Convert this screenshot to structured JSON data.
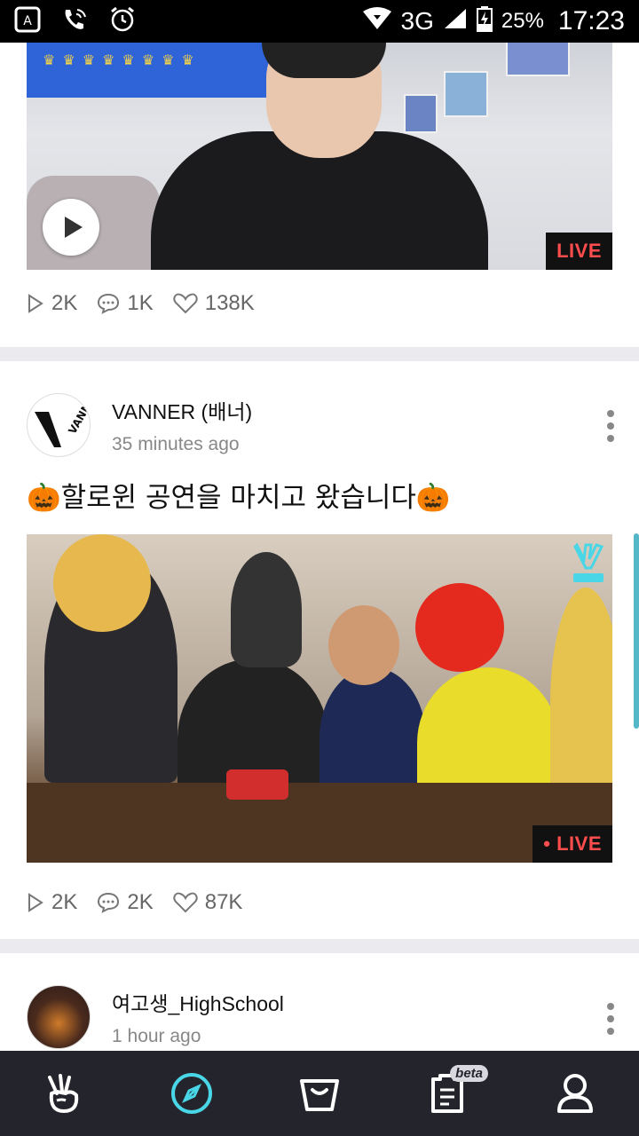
{
  "status_bar": {
    "network": "3G",
    "battery": "25%",
    "time": "17:23"
  },
  "posts": [
    {
      "live_label": "LIVE",
      "plays": "2K",
      "comments": "1K",
      "likes": "138K"
    },
    {
      "author": "VANNER (배너)",
      "time_ago": "35 minutes ago",
      "text": "🎃할로윈 공연을 마치고 왔습니다🎃",
      "live_label": "• LIVE",
      "plays": "2K",
      "comments": "2K",
      "likes": "87K"
    },
    {
      "author": "여고생_HighSchool",
      "time_ago": "1 hour ago"
    }
  ],
  "nav": {
    "items": [
      "home-icon",
      "discover-icon",
      "store-icon",
      "board-icon",
      "profile-icon"
    ],
    "badge": "beta",
    "active": "discover-icon"
  },
  "colors": {
    "accent": "#49d6e6",
    "live_red": "#ff4d4d",
    "nav_bg": "#24242c"
  }
}
